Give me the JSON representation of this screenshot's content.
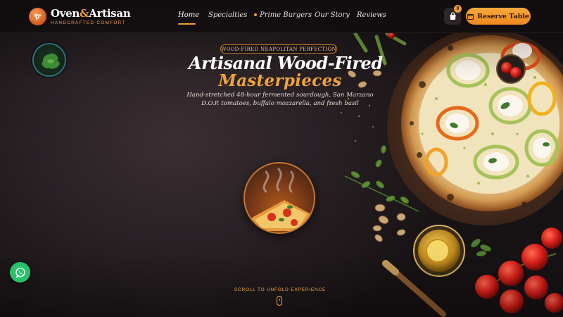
{
  "brand": {
    "name_part1": "Oven",
    "name_amp": "&",
    "name_part2": "Artisan",
    "tagline": "HANDCRAFTED COMFORT"
  },
  "nav": {
    "items": [
      {
        "label": "Home",
        "active": true
      },
      {
        "label": "Specialties",
        "active": false
      },
      {
        "label": "Prime Burgers",
        "active": false,
        "dot": true
      },
      {
        "label": "Our Story",
        "active": false
      },
      {
        "label": "Reviews",
        "active": false
      }
    ]
  },
  "cart": {
    "count": "0",
    "icon": "shopping-bag-icon"
  },
  "reserve": {
    "label": "Reserve Table",
    "icon": "calendar-icon"
  },
  "hero": {
    "badge": "WOOD-FIRED NEAPOLITAN PERFECTION",
    "title_line1": "Artisanal Wood-Fired",
    "title_line2": "Masterpieces",
    "subtitle": "Hand-stretched 48-hour fermented sourdough, San Marzano D.O.P. tomatoes, buffalo mozzarella, and fresh basil"
  },
  "scroll": {
    "label": "SCROLL TO UNFOLD EXPERIENCE"
  },
  "whatsapp": {
    "icon": "whatsapp-icon"
  },
  "colors": {
    "accent": "#f39c32",
    "background": "#1f191b",
    "header": "#120e0f",
    "whatsapp": "#25c26a"
  }
}
